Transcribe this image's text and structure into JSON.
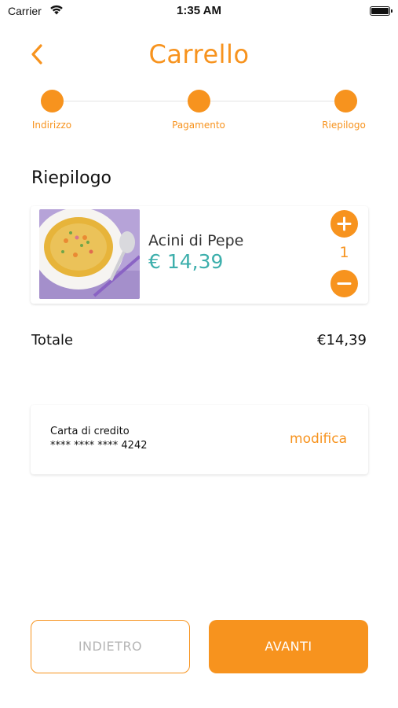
{
  "status_bar": {
    "carrier": "Carrier",
    "time": "1:35 AM"
  },
  "header": {
    "title": "Carrello",
    "back_icon": "chevron-left-icon"
  },
  "steps": [
    {
      "label": "Indirizzo",
      "state": "completed"
    },
    {
      "label": "Pagamento",
      "state": "completed"
    },
    {
      "label": "Riepilogo",
      "state": "current"
    }
  ],
  "summary": {
    "title": "Riepilogo"
  },
  "cart_items": [
    {
      "name": "Acini di Pepe",
      "price": "€ 14,39",
      "quantity": "1",
      "image": "soup-bowl-photo"
    }
  ],
  "total": {
    "label": "Totale",
    "value": "€14,39"
  },
  "payment": {
    "title": "Carta di credito",
    "card_number": "**** **** **** 4242",
    "edit_label": "modifica"
  },
  "buttons": {
    "back_label": "INDIETRO",
    "next_label": "AVANTI"
  },
  "colors": {
    "accent": "#F7931E",
    "price": "#3DAFAC",
    "disabled_text": "#B5B5B5"
  }
}
